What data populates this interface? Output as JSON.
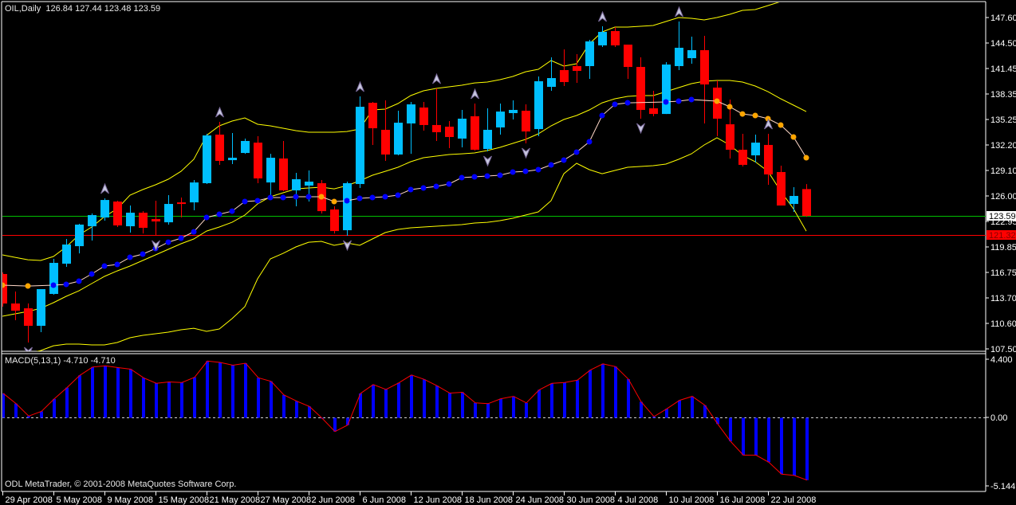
{
  "header": {
    "symbol": "OIL,Daily",
    "ohlc_readout": "126.84 127.44 123.48 123.59"
  },
  "macd_panel": {
    "label": "MACD(5,13,1) -4.710 -4.710"
  },
  "copyright": "ODL MetaTrader, © 2001-2008 MetaQuotes Software Corp.",
  "colors": {
    "background": "#000000",
    "frame": "#ffffff",
    "bull": "#00bfff",
    "bear": "#ff0000",
    "bands": "#ffff00",
    "dots_line": "#ffd8c8",
    "dot_blue": "#0000ff",
    "dot_orange": "#ffa500",
    "bid_line": "#00c000",
    "level_line": "#ff0000",
    "macd_bar": "#0000ff",
    "macd_line": "#ff0000",
    "fractal_fill": "#c8c8e0",
    "fractal_stroke": "#7a6a9a"
  },
  "chart_data": [
    {
      "type": "candlestick",
      "title": "OIL,Daily",
      "ylim": [
        107.5,
        147.6
      ],
      "grid": false,
      "y_tick_values": [
        147.6,
        144.5,
        141.45,
        138.35,
        135.25,
        132.2,
        129.1,
        126.0,
        122.95,
        119.85,
        116.75,
        113.7,
        110.6,
        107.5
      ],
      "y_tick_labels": [
        "147.60",
        "144.50",
        "141.45",
        "138.35",
        "135.25",
        "132.20",
        "129.10",
        "126.00",
        "122.95",
        "119.85",
        "116.75",
        "113.70",
        "110.60",
        "107.50"
      ],
      "x_tick_labels": [
        "29 Apr 2008",
        "5 May 2008",
        "9 May 2008",
        "15 May 2008",
        "21 May 2008",
        "27 May 2008",
        "2 Jun 2008",
        "6 Jun 2008",
        "12 Jun 2008",
        "18 Jun 2008",
        "24 Jun 2008",
        "30 Jun 2008",
        "4 Jul 2008",
        "10 Jul 2008",
        "16 Jul 2008",
        "22 Jul 2008"
      ],
      "x_tick_dates": [
        "2008-04-29",
        "2008-05-05",
        "2008-05-09",
        "2008-05-15",
        "2008-05-21",
        "2008-05-27",
        "2008-06-02",
        "2008-06-06",
        "2008-06-12",
        "2008-06-18",
        "2008-06-24",
        "2008-06-30",
        "2008-07-04",
        "2008-07-10",
        "2008-07-16",
        "2008-07-22"
      ],
      "dates": [
        "2008-04-29",
        "2008-04-30",
        "2008-05-01",
        "2008-05-02",
        "2008-05-05",
        "2008-05-06",
        "2008-05-07",
        "2008-05-08",
        "2008-05-09",
        "2008-05-12",
        "2008-05-13",
        "2008-05-14",
        "2008-05-15",
        "2008-05-16",
        "2008-05-19",
        "2008-05-20",
        "2008-05-21",
        "2008-05-22",
        "2008-05-23",
        "2008-05-26",
        "2008-05-27",
        "2008-05-28",
        "2008-05-29",
        "2008-05-30",
        "2008-06-02",
        "2008-06-03",
        "2008-06-04",
        "2008-06-05",
        "2008-06-06",
        "2008-06-09",
        "2008-06-10",
        "2008-06-11",
        "2008-06-12",
        "2008-06-13",
        "2008-06-16",
        "2008-06-17",
        "2008-06-18",
        "2008-06-19",
        "2008-06-20",
        "2008-06-23",
        "2008-06-24",
        "2008-06-25",
        "2008-06-26",
        "2008-06-27",
        "2008-06-30",
        "2008-07-01",
        "2008-07-02",
        "2008-07-03",
        "2008-07-04",
        "2008-07-07",
        "2008-07-08",
        "2008-07-09",
        "2008-07-10",
        "2008-07-11",
        "2008-07-14",
        "2008-07-15",
        "2008-07-16",
        "2008-07-17",
        "2008-07-18",
        "2008-07-21",
        "2008-07-22",
        "2008-07-23",
        "2008-07-24",
        "2008-07-25"
      ],
      "ohlc": [
        [
          116.56,
          116.75,
          112.61,
          112.99
        ],
        [
          112.99,
          114.44,
          110.97,
          112.12
        ],
        [
          112.41,
          112.99,
          108.27,
          110.29
        ],
        [
          110.29,
          114.73,
          109.52,
          114.73
        ],
        [
          114.15,
          118.39,
          114.05,
          117.91
        ],
        [
          117.81,
          120.8,
          117.43,
          120.13
        ],
        [
          119.93,
          122.63,
          119.06,
          122.54
        ],
        [
          122.34,
          123.89,
          120.61,
          123.69
        ],
        [
          123.4,
          125.72,
          123.02,
          125.52
        ],
        [
          125.33,
          125.43,
          122.25,
          122.44
        ],
        [
          122.34,
          124.85,
          121.57,
          123.98
        ],
        [
          123.98,
          124.17,
          121.47,
          122.15
        ],
        [
          123.21,
          125.43,
          121.19,
          122.92
        ],
        [
          122.82,
          126.1,
          122.54,
          125.04
        ],
        [
          125.23,
          125.81,
          123.4,
          125.04
        ],
        [
          125.23,
          127.93,
          124.27,
          127.64
        ],
        [
          127.55,
          133.53,
          127.45,
          133.33
        ],
        [
          133.43,
          134.97,
          129.77,
          130.25
        ],
        [
          130.34,
          133.62,
          129.86,
          130.63
        ],
        [
          131.21,
          132.95,
          131.11,
          132.66
        ],
        [
          132.46,
          133.24,
          127.55,
          128.13
        ],
        [
          127.64,
          131.11,
          125.91,
          130.63
        ],
        [
          130.54,
          132.66,
          126.58,
          126.68
        ],
        [
          126.68,
          128.8,
          124.75,
          128.03
        ],
        [
          127.26,
          129.09,
          125.33,
          127.74
        ],
        [
          127.55,
          127.93,
          123.89,
          124.17
        ],
        [
          124.37,
          124.75,
          121.47,
          121.76
        ],
        [
          121.86,
          127.74,
          121.19,
          127.55
        ],
        [
          127.45,
          138.06,
          126.97,
          136.8
        ],
        [
          137.28,
          137.38,
          132.18,
          134.2
        ],
        [
          134.01,
          137.57,
          130.25,
          131.02
        ],
        [
          131.02,
          136.32,
          130.92,
          134.87
        ],
        [
          134.78,
          137.38,
          131.11,
          137.09
        ],
        [
          136.71,
          137.38,
          133.91,
          134.59
        ],
        [
          134.59,
          139.02,
          132.66,
          133.72
        ],
        [
          134.39,
          135.07,
          131.79,
          133.14
        ],
        [
          132.95,
          136.42,
          131.89,
          135.36
        ],
        [
          135.65,
          137.19,
          131.5,
          131.6
        ],
        [
          131.69,
          136.61,
          131.4,
          134.01
        ],
        [
          134.3,
          137.19,
          133.43,
          136.22
        ],
        [
          136.03,
          137.57,
          135.26,
          136.42
        ],
        [
          136.32,
          137.09,
          132.37,
          133.81
        ],
        [
          134.1,
          140.47,
          133.24,
          139.89
        ],
        [
          139.21,
          142.78,
          138.73,
          140.27
        ],
        [
          141.24,
          143.74,
          139.31,
          139.79
        ],
        [
          141.72,
          143.16,
          139.69,
          141.14
        ],
        [
          141.72,
          144.9,
          140.18,
          144.71
        ],
        [
          144.23,
          146.54,
          144.03,
          145.86
        ],
        [
          145.96,
          146.44,
          144.03,
          144.23
        ],
        [
          144.32,
          144.32,
          140.18,
          141.62
        ],
        [
          141.62,
          142.78,
          135.36,
          136.42
        ],
        [
          136.61,
          138.73,
          135.65,
          135.93
        ],
        [
          135.93,
          142.2,
          135.93,
          141.91
        ],
        [
          141.72,
          147.12,
          141.24,
          143.94
        ],
        [
          142.68,
          145.29,
          142.01,
          143.65
        ],
        [
          143.65,
          145.38,
          134.78,
          139.5
        ],
        [
          139.12,
          139.98,
          133.24,
          135.36
        ],
        [
          134.68,
          137.67,
          130.54,
          131.6
        ],
        [
          131.6,
          133.53,
          129.57,
          129.77
        ],
        [
          130.92,
          133.43,
          130.05,
          132.46
        ],
        [
          132.18,
          133.53,
          127.36,
          128.61
        ],
        [
          128.9,
          129.67,
          124.85,
          124.85
        ],
        [
          125.04,
          127.07,
          124.08,
          126.01
        ],
        [
          126.84,
          127.44,
          123.48,
          123.59
        ]
      ],
      "bands": {
        "upper": [
          118.87,
          118.58,
          118.29,
          118.2,
          118.68,
          119.84,
          121.28,
          122.25,
          123.5,
          124.46,
          126.1,
          126.78,
          127.36,
          128.03,
          128.99,
          130.44,
          133.33,
          134.49,
          135.07,
          135.45,
          134.68,
          134.49,
          134.2,
          133.91,
          133.72,
          133.72,
          133.72,
          133.81,
          134.1,
          136.42,
          136.51,
          137.19,
          138.15,
          138.73,
          139.02,
          139.21,
          139.41,
          139.69,
          139.79,
          140.08,
          140.47,
          141.04,
          141.33,
          142.39,
          141.72,
          142.01,
          144.42,
          145.86,
          146.44,
          146.44,
          146.54,
          146.64,
          147.12,
          147.6,
          147.5,
          147.31,
          147.6,
          147.99,
          148.47,
          148.56,
          149.05,
          149.53,
          150.01,
          150.49
        ],
        "middle": [
          111.45,
          111.74,
          112.03,
          112.41,
          113.09,
          113.86,
          114.53,
          115.4,
          116.27,
          116.94,
          117.52,
          118.2,
          118.87,
          119.55,
          120.22,
          120.8,
          121.76,
          122.25,
          122.82,
          123.69,
          125.04,
          125.91,
          126.39,
          126.87,
          126.97,
          127.07,
          126.87,
          127.26,
          127.84,
          128.51,
          128.99,
          129.48,
          130.15,
          130.63,
          130.83,
          131.02,
          131.11,
          131.21,
          131.5,
          131.89,
          132.37,
          132.85,
          133.53,
          134.49,
          135.26,
          135.74,
          136.42,
          137.28,
          137.77,
          138.06,
          138.15,
          138.15,
          138.63,
          139.12,
          139.6,
          139.89,
          139.98,
          139.98,
          139.79,
          139.31,
          138.63,
          137.77,
          137.0,
          136.22
        ],
        "lower": [
          105.86,
          106.34,
          106.92,
          107.3,
          107.88,
          108.08,
          108.08,
          107.98,
          107.98,
          108.27,
          108.85,
          109.14,
          109.33,
          109.52,
          109.81,
          110.0,
          109.62,
          109.91,
          111.16,
          112.61,
          115.98,
          118.39,
          119.06,
          119.84,
          120.41,
          120.51,
          120.03,
          120.32,
          120.03,
          120.8,
          121.57,
          121.96,
          122.15,
          122.25,
          122.34,
          122.44,
          122.54,
          122.73,
          122.82,
          123.02,
          123.31,
          123.69,
          124.08,
          125.43,
          128.7,
          129.96,
          129.19,
          128.7,
          129.09,
          129.48,
          129.57,
          129.67,
          129.86,
          130.44,
          131.11,
          132.18,
          133.04,
          132.18,
          130.92,
          130.15,
          128.99,
          126.58,
          124.46,
          121.76
        ]
      },
      "dots": {
        "values": [
          115.21,
          null,
          115.11,
          null,
          115.21,
          115.31,
          115.69,
          116.56,
          117.52,
          117.72,
          118.58,
          118.97,
          119.64,
          120.41,
          120.9,
          121.67,
          123.4,
          123.79,
          124.17,
          125.33,
          125.43,
          125.81,
          125.81,
          125.91,
          125.91,
          125.91,
          125.33,
          125.43,
          125.72,
          125.81,
          125.91,
          126.1,
          126.78,
          126.97,
          127.16,
          127.45,
          128.22,
          128.32,
          128.42,
          128.51,
          128.9,
          128.99,
          129.19,
          129.77,
          130.34,
          131.31,
          132.56,
          135.74,
          137.09,
          137.28,
          null,
          null,
          137.38,
          137.48,
          137.67,
          null,
          137.48,
          136.8,
          135.93,
          135.74,
          135.36,
          134.59,
          133.14,
          130.63
        ],
        "orange_dates": [
          "2008-04-29",
          "2008-05-01",
          "2008-06-03",
          "2008-06-04",
          "2008-07-16",
          "2008-07-17",
          "2008-07-18",
          "2008-07-21",
          "2008-07-22",
          "2008-07-23",
          "2008-07-24",
          "2008-07-25"
        ]
      },
      "fractals_up": [
        "2008-05-09",
        "2008-05-22",
        "2008-06-06",
        "2008-06-16",
        "2008-06-19",
        "2008-07-03",
        "2008-07-11",
        "2008-07-22"
      ],
      "fractals_down": [
        "2008-05-01",
        "2008-05-15",
        "2008-06-05",
        "2008-06-20",
        "2008-06-25",
        "2008-07-08"
      ],
      "hlines": [
        {
          "value": 123.59,
          "label": "123.59",
          "kind": "bid"
        },
        {
          "value": 121.32,
          "label": "121.32",
          "kind": "level"
        }
      ]
    },
    {
      "type": "bar",
      "title": "MACD(5,13,1) -4.710 -4.710",
      "ylim": [
        -5.144,
        4.4
      ],
      "y_tick_values": [
        4.4,
        0.0,
        -5.144
      ],
      "y_tick_labels": [
        "4.400",
        "0.00",
        "-5.144"
      ],
      "values": [
        1.83,
        1.06,
        0.12,
        0.47,
        1.41,
        2.26,
        3.18,
        3.81,
        3.91,
        3.77,
        3.65,
        3.0,
        2.59,
        2.69,
        2.65,
        3.04,
        4.26,
        4.16,
        3.95,
        4.1,
        3.0,
        2.73,
        1.71,
        1.24,
        0.84,
        -0.05,
        -1.05,
        -0.56,
        1.82,
        2.49,
        2.12,
        2.62,
        3.21,
        2.88,
        2.4,
        1.85,
        1.91,
        1.11,
        1.05,
        1.42,
        1.6,
        1.11,
        2.09,
        2.58,
        2.64,
        2.82,
        3.58,
        4.05,
        3.84,
        2.9,
        1.19,
        0.08,
        0.66,
        1.3,
        1.6,
        0.93,
        -0.48,
        -1.78,
        -2.83,
        -2.83,
        -3.36,
        -4.26,
        -4.36,
        -4.71
      ]
    }
  ]
}
